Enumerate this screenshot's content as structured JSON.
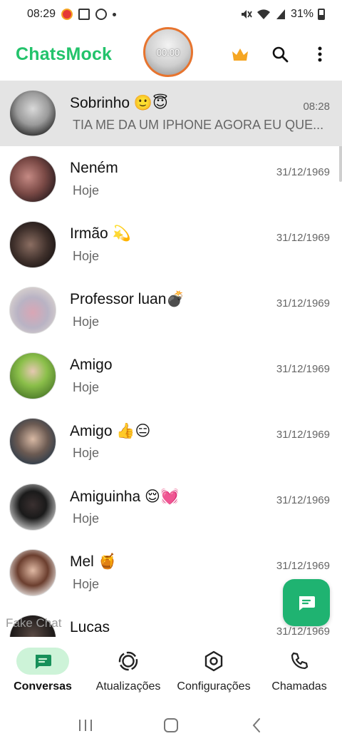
{
  "status_bar": {
    "time": "08:29",
    "battery": "31%"
  },
  "header": {
    "title": "ChatsMock",
    "recording_time": "00:00"
  },
  "chats": [
    {
      "name": "Sobrinho 🙂😇",
      "preview": "TIA ME DA UM IPHONE AGORA EU QUE...",
      "time": "08:28"
    },
    {
      "name": "Neném",
      "preview": "Hoje",
      "time": "31/12/1969"
    },
    {
      "name": "Irmão 💫",
      "preview": "Hoje",
      "time": "31/12/1969"
    },
    {
      "name": "Professor luan💣",
      "preview": "Hoje",
      "time": "31/12/1969"
    },
    {
      "name": "Amigo",
      "preview": "Hoje",
      "time": "31/12/1969"
    },
    {
      "name": "Amigo 👍😑",
      "preview": "Hoje",
      "time": "31/12/1969"
    },
    {
      "name": "Amiguinha 😌💓",
      "preview": "Hoje",
      "time": "31/12/1969"
    },
    {
      "name": "Mel 🍯",
      "preview": "Hoje",
      "time": "31/12/1969"
    },
    {
      "name": "Lucas",
      "preview": "",
      "time": "31/12/1969"
    }
  ],
  "watermark": "Fake Chat",
  "bottom_nav": [
    {
      "label": "Conversas",
      "icon": "chat-icon"
    },
    {
      "label": "Atualizações",
      "icon": "status-icon"
    },
    {
      "label": "Configurações",
      "icon": "settings-icon"
    },
    {
      "label": "Chamadas",
      "icon": "phone-icon"
    }
  ],
  "colors": {
    "brand": "#23c36b",
    "fab": "#1fb371",
    "active_nav_bg": "#cdf3d8",
    "selected_row": "#e4e4e4"
  }
}
